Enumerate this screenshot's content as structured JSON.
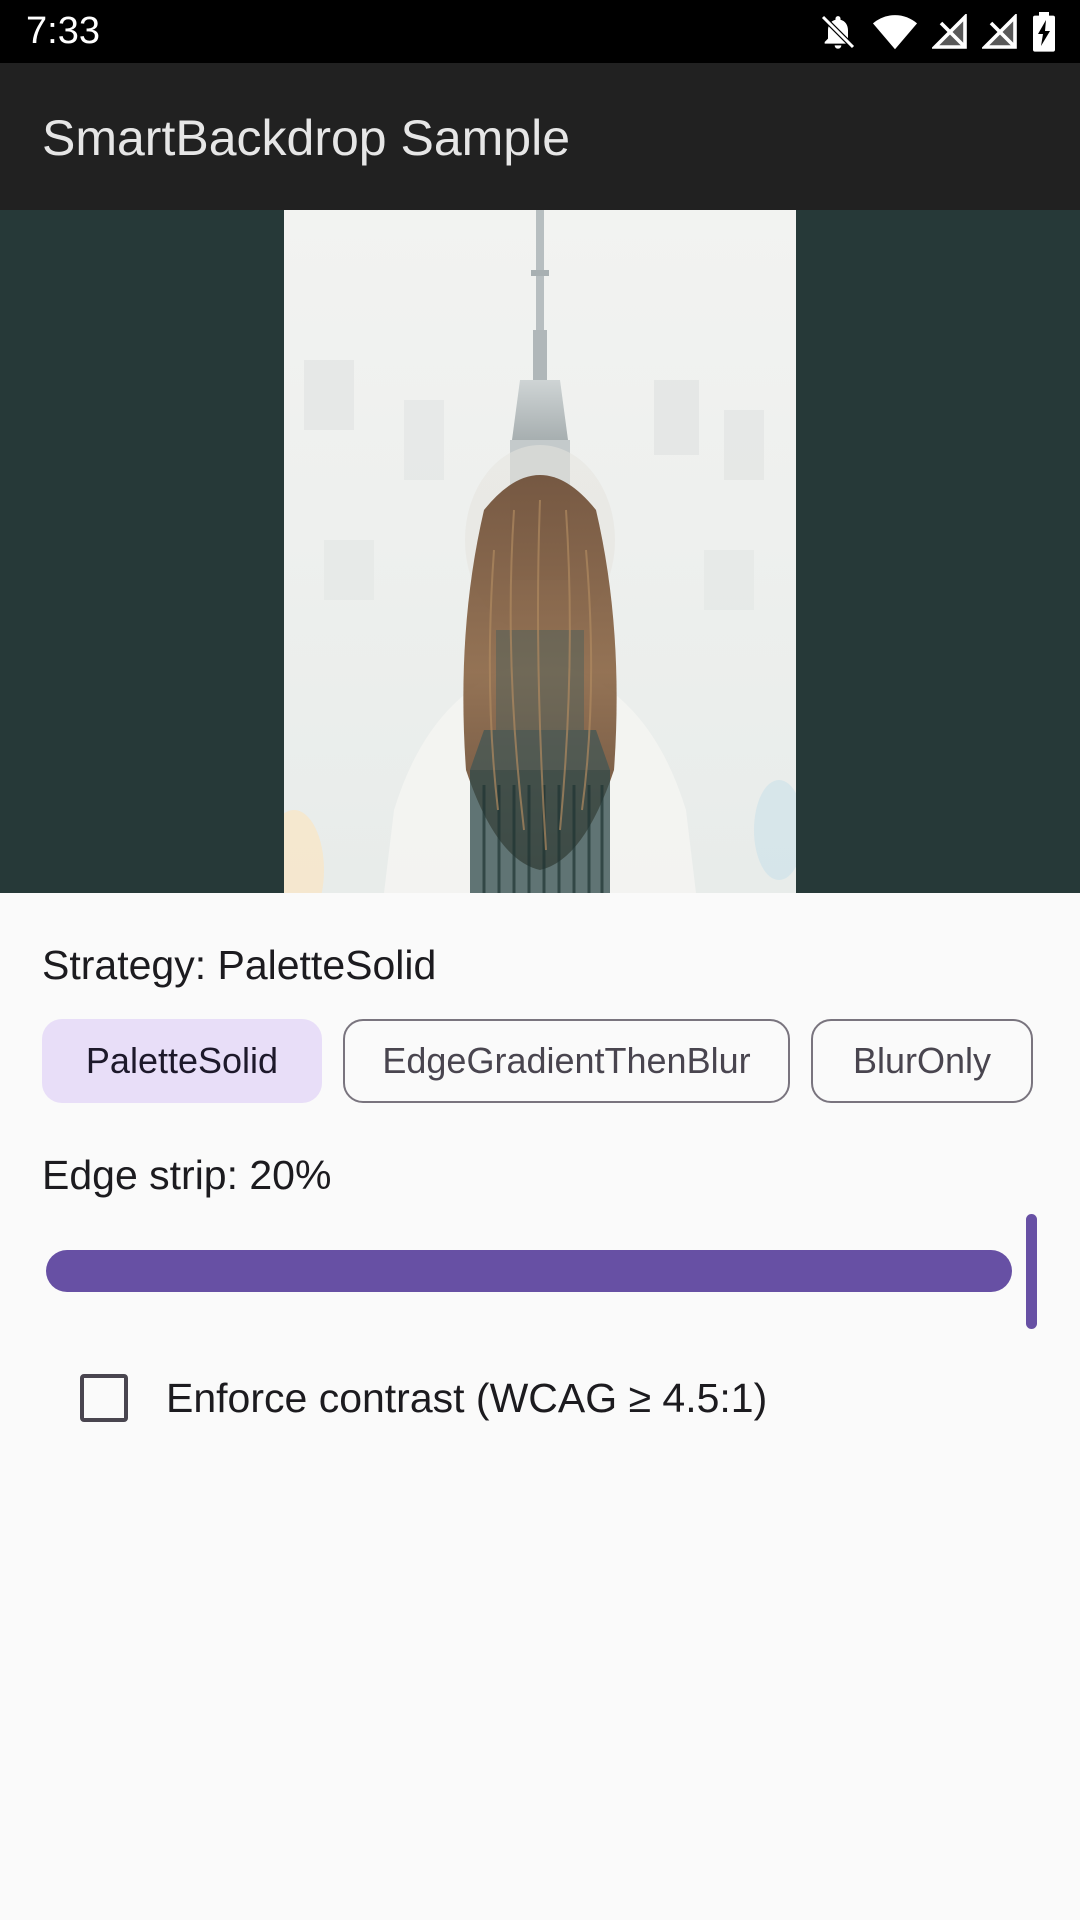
{
  "status_bar": {
    "time": "7:33",
    "icons": [
      "notifications-off-icon",
      "wifi-icon",
      "signal-off-icon",
      "signal-off-icon",
      "battery-charging-icon"
    ]
  },
  "app_bar": {
    "title": "SmartBackdrop Sample"
  },
  "preview": {
    "backdrop_color": "#263938",
    "image": "woman-and-skyscraper-double-exposure-photo"
  },
  "strategy": {
    "label": "Strategy: PaletteSolid",
    "options": [
      "PaletteSolid",
      "EdgeGradientThenBlur",
      "BlurOnly"
    ],
    "selected": "PaletteSolid"
  },
  "edge_strip": {
    "label": "Edge strip: 20%",
    "value_percent": 20,
    "slider_fill_fraction": 1.0
  },
  "contrast": {
    "label": "Enforce contrast (WCAG ≥ 4.5:1)",
    "checked": false
  },
  "colors": {
    "status_bar": "#000000",
    "app_bar": "#212121",
    "accent": "#6750a4",
    "selected_chip": "#e8def8",
    "background": "#fafafa"
  }
}
